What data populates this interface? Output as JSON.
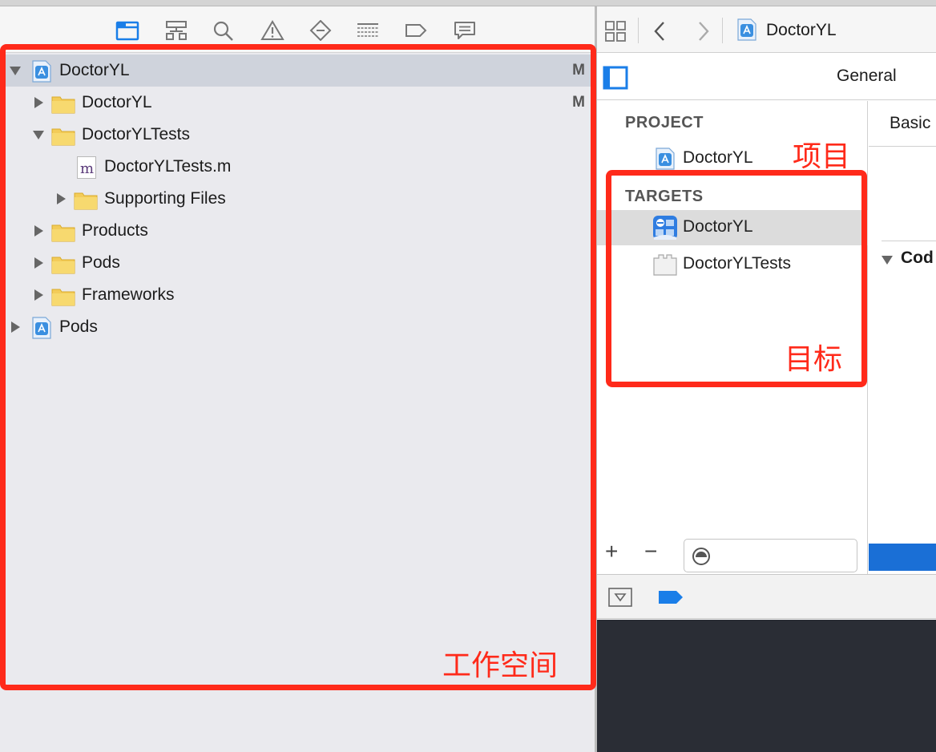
{
  "navigator": {
    "toolbar_icons": [
      "project-navigator-icon",
      "symbol-navigator-icon",
      "find-navigator-icon",
      "issue-navigator-icon",
      "test-navigator-icon",
      "debug-navigator-icon",
      "breakpoint-navigator-icon",
      "report-navigator-icon"
    ],
    "tree": [
      {
        "label": "DoctorYL",
        "badge": "M",
        "type": "project",
        "expanded": true,
        "selected": true
      },
      {
        "label": "DoctorYL",
        "badge": "M",
        "type": "folder",
        "expanded": false
      },
      {
        "label": "DoctorYLTests",
        "badge": "",
        "type": "folder",
        "expanded": true
      },
      {
        "label": "DoctorYLTests.m",
        "badge": "",
        "type": "file",
        "file_glyph": "m"
      },
      {
        "label": "Supporting Files",
        "badge": "",
        "type": "folder",
        "expanded": false
      },
      {
        "label": "Products",
        "badge": "",
        "type": "folder",
        "expanded": false
      },
      {
        "label": "Pods",
        "badge": "",
        "type": "folder",
        "expanded": false
      },
      {
        "label": "Frameworks",
        "badge": "",
        "type": "folder",
        "expanded": false
      },
      {
        "label": "Pods",
        "badge": "",
        "type": "project",
        "expanded": false
      }
    ]
  },
  "jump_bar": {
    "title": "DoctorYL"
  },
  "editor": {
    "tab_general": "General",
    "detail_tab": "Basic",
    "detail_section": "Cod",
    "project_header": "PROJECT",
    "project_item": "DoctorYL",
    "targets_header": "TARGETS",
    "targets": [
      {
        "label": "DoctorYL",
        "selected": true
      },
      {
        "label": "DoctorYLTests",
        "selected": false
      }
    ],
    "add_symbol": "+",
    "remove_symbol": "−",
    "filter_value": ""
  },
  "annotations": {
    "workspace_label": "工作空间",
    "project_label": "项目",
    "targets_label": "目标"
  },
  "colors": {
    "annotation_red": "#ff2a1a",
    "accent_blue": "#1a7ee8",
    "console_bg": "#2a2d35"
  }
}
